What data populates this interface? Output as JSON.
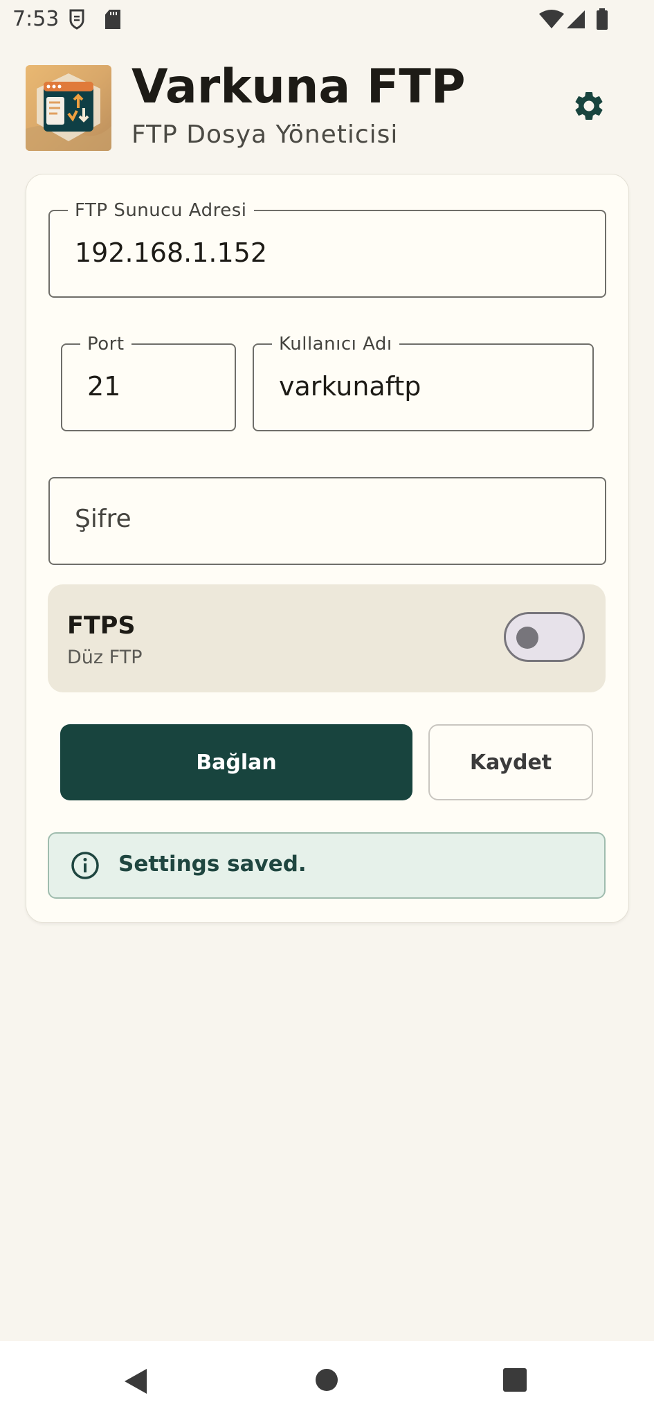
{
  "status_bar": {
    "time": "7:53"
  },
  "header": {
    "title": "Varkuna FTP",
    "subtitle": "FTP Dosya Yöneticisi",
    "settings_icon": "gear-icon"
  },
  "form": {
    "server": {
      "label": "FTP Sunucu Adresi",
      "value": "192.168.1.152"
    },
    "port": {
      "label": "Port",
      "value": "21"
    },
    "username": {
      "label": "Kullanıcı Adı",
      "value": "varkunaftp"
    },
    "password": {
      "placeholder": "Şifre"
    },
    "ftps": {
      "title": "FTPS",
      "subtitle": "Düz FTP",
      "enabled": false
    }
  },
  "actions": {
    "connect_label": "Bağlan",
    "save_label": "Kaydet"
  },
  "info": {
    "message": "Settings saved."
  },
  "colors": {
    "primary": "#18443e",
    "background": "#f8f5ee",
    "card": "#fffdf6",
    "info_bg": "#e6f1ea"
  }
}
